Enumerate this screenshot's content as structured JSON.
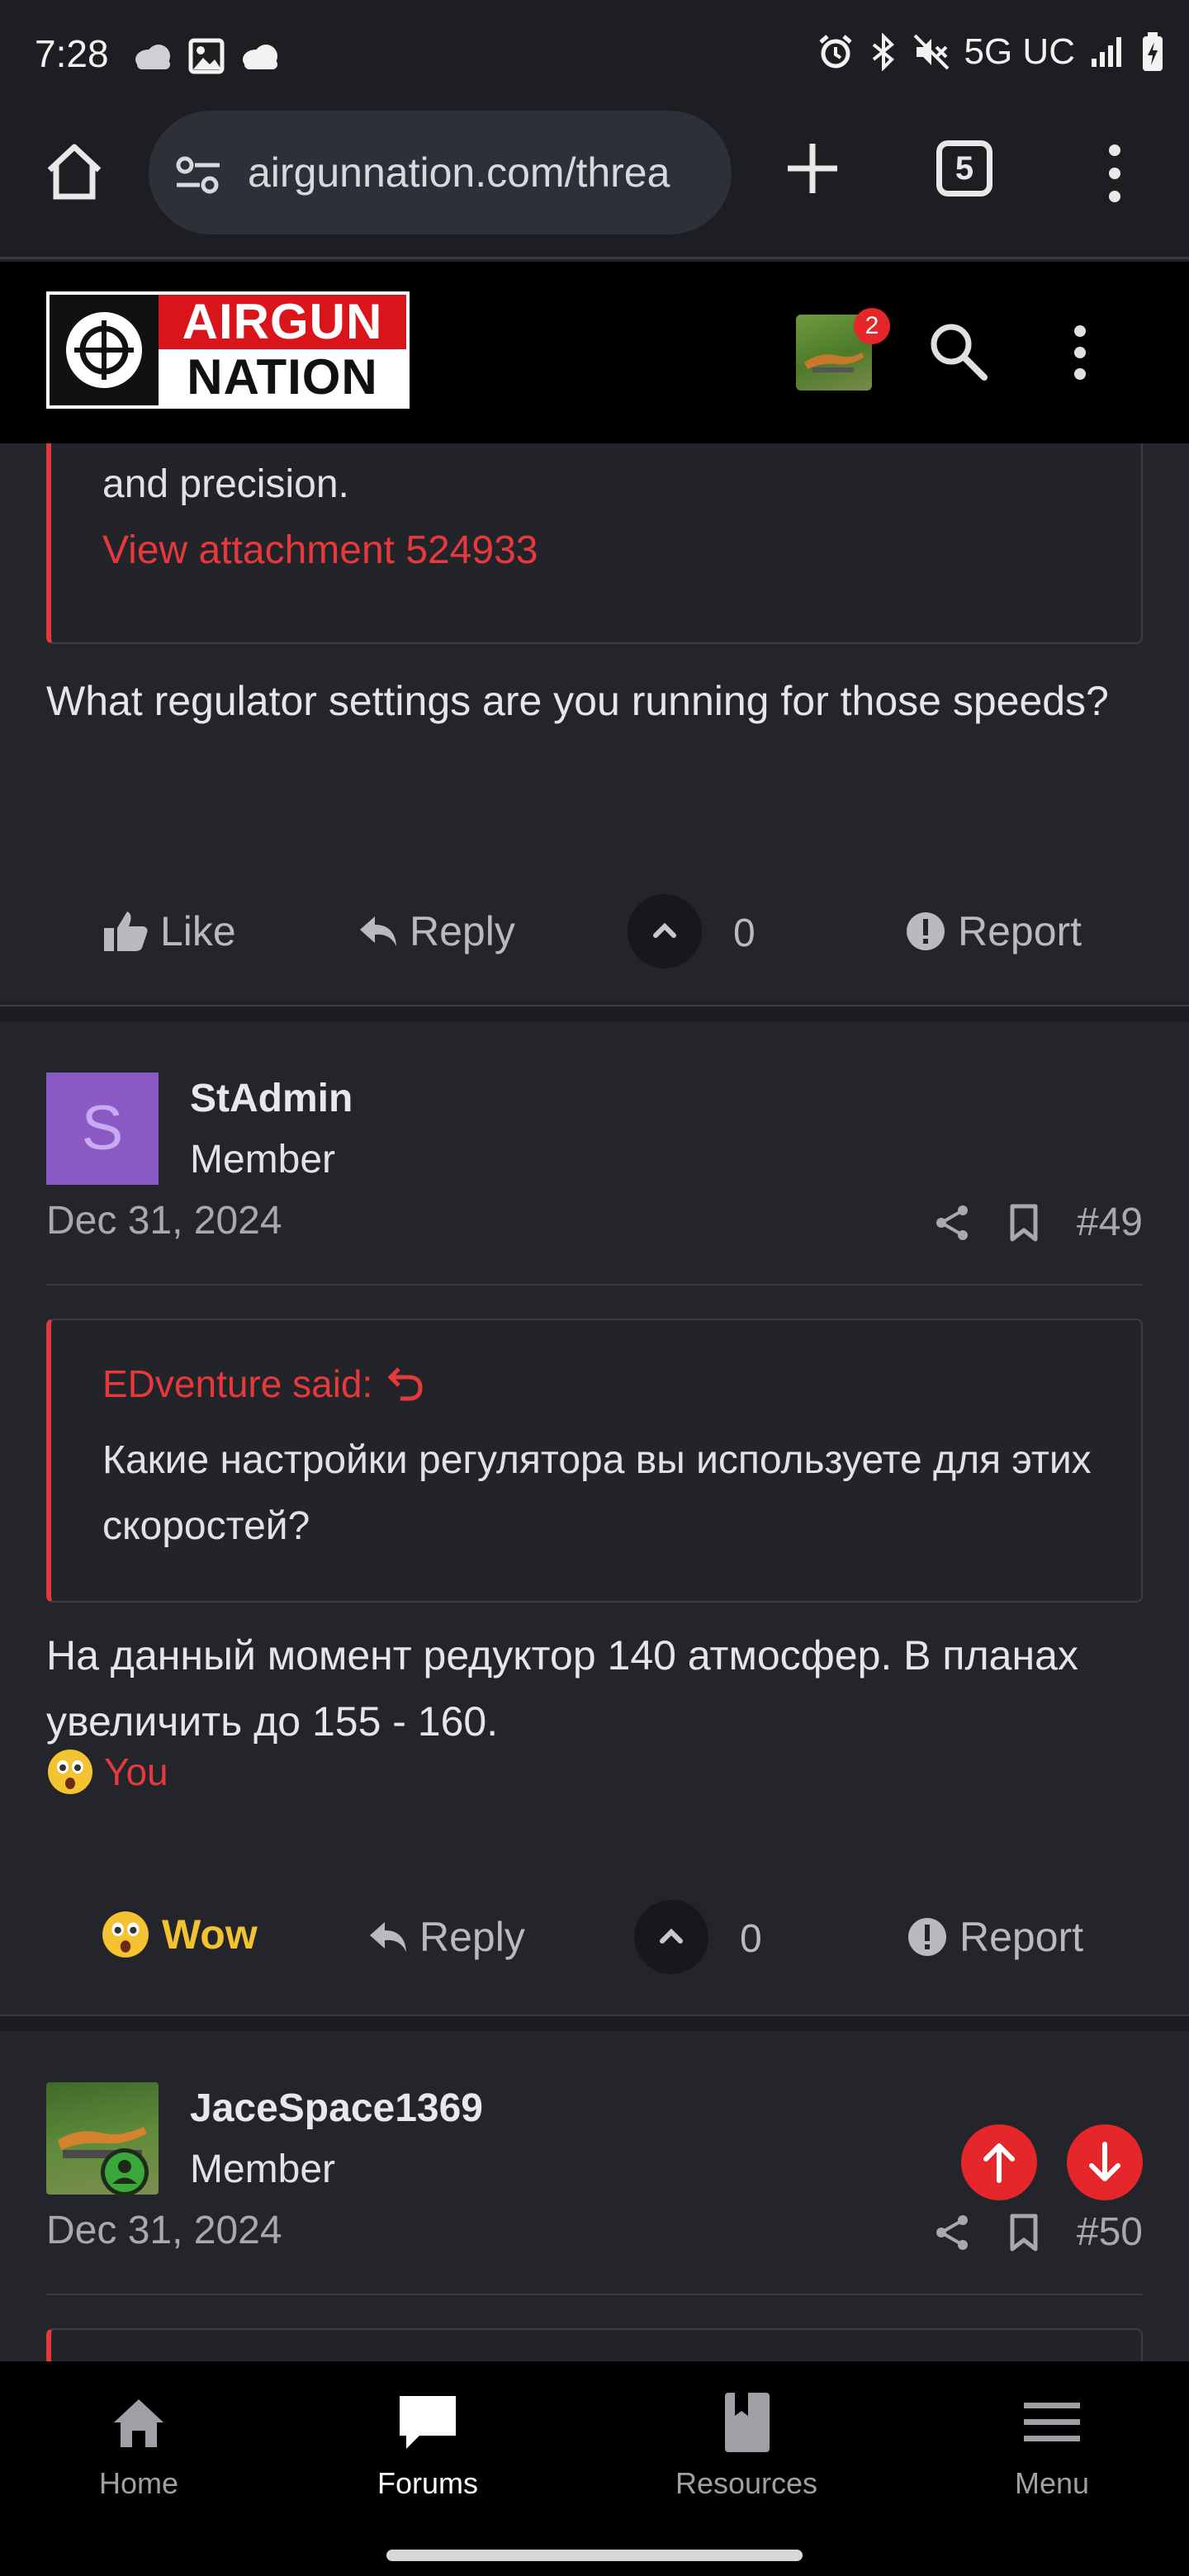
{
  "status_bar": {
    "time": "7:28",
    "network": "5G UC"
  },
  "browser": {
    "url": "airgunnation.com/threa",
    "tab_count": "5"
  },
  "site": {
    "logo_line1": "AIRGUN",
    "logo_line2": "NATION",
    "notification_count": "2"
  },
  "post_prev": {
    "quote_tail": "and precision.",
    "attachment_link": "View attachment 524933",
    "body": "What regulator settings are you running for those speeds?",
    "actions": {
      "like": "Like",
      "reply": "Reply",
      "votes": "0",
      "report": "Report"
    }
  },
  "post_49": {
    "avatar_letter": "S",
    "author": "StAdmin",
    "role": "Member",
    "date": "Dec 31, 2024",
    "number": "#49",
    "quote_author": "EDventure said:",
    "quote_text": "Какие настройки регулятора вы используете для этих скоростей?",
    "body": "На данный момент редуктор 140 атмосфер. В планах увеличить до 155 - 160.",
    "reaction_user": "You",
    "actions": {
      "reaction": "Wow",
      "reply": "Reply",
      "votes": "0",
      "report": "Report"
    }
  },
  "post_50": {
    "author": "JaceSpace1369",
    "role": "Member",
    "date": "Dec 31, 2024",
    "number": "#50"
  },
  "bottom_nav": {
    "items": [
      {
        "label": "Home"
      },
      {
        "label": "Forums"
      },
      {
        "label": "Resources"
      },
      {
        "label": "Menu"
      }
    ],
    "active": "Forums"
  },
  "colors": {
    "accent_red": "#e5393b",
    "background": "#24252b",
    "wow_yellow": "#f2c230"
  }
}
